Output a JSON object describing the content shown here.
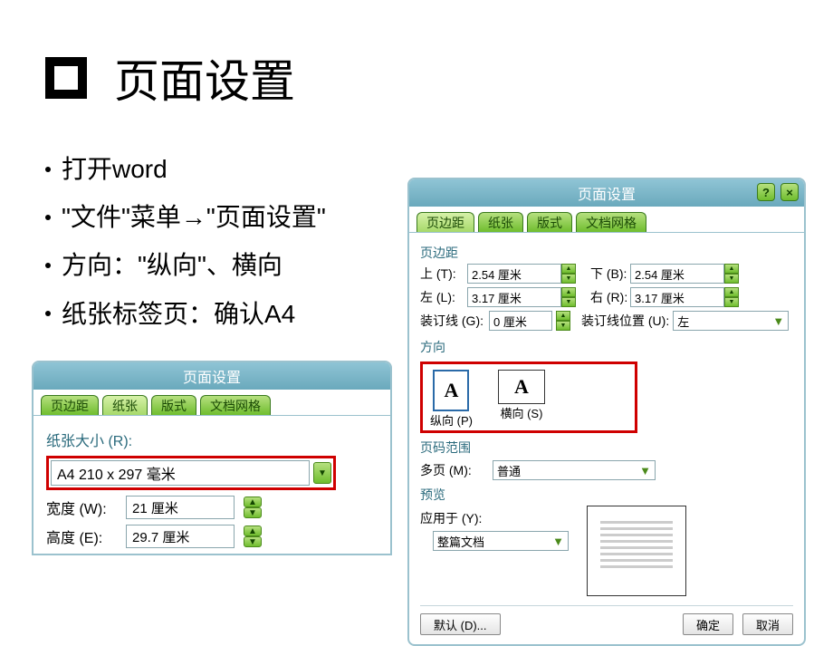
{
  "slide": {
    "title": "页面设置",
    "bullets": [
      "打开word",
      "\"文件\"菜单→\"页面设置\"",
      "方向：\"纵向\"、横向",
      "纸张标签页：确认A4"
    ]
  },
  "dialog_small": {
    "title": "页面设置",
    "tabs": [
      "页边距",
      "纸张",
      "版式",
      "文档网格"
    ],
    "active_tab": "纸张",
    "paper_size_label": "纸张大小 (R):",
    "paper_size_value": "A4 210 x 297 毫米",
    "width_label": "宽度 (W):",
    "width_value": "21 厘米",
    "height_label": "高度 (E):",
    "height_value": "29.7 厘米"
  },
  "dialog_large": {
    "title": "页面设置",
    "help_icon": "?",
    "close_icon": "×",
    "tabs": [
      "页边距",
      "纸张",
      "版式",
      "文档网格"
    ],
    "active_tab": "页边距",
    "margins_section": "页边距",
    "top_label": "上 (T):",
    "top_value": "2.54 厘米",
    "bottom_label": "下 (B):",
    "bottom_value": "2.54 厘米",
    "left_label": "左 (L):",
    "left_value": "3.17 厘米",
    "right_label": "右 (R):",
    "right_value": "3.17 厘米",
    "gutter_label": "装订线 (G):",
    "gutter_value": "0 厘米",
    "gutter_pos_label": "装订线位置 (U):",
    "gutter_pos_value": "左",
    "orientation_section": "方向",
    "portrait_label": "纵向 (P)",
    "landscape_label": "横向 (S)",
    "pages_section": "页码范围",
    "multipage_label": "多页 (M):",
    "multipage_value": "普通",
    "preview_section": "预览",
    "apply_to_label": "应用于 (Y):",
    "apply_to_value": "整篇文档",
    "default_button": "默认 (D)...",
    "ok_button": "确定",
    "cancel_button": "取消"
  }
}
